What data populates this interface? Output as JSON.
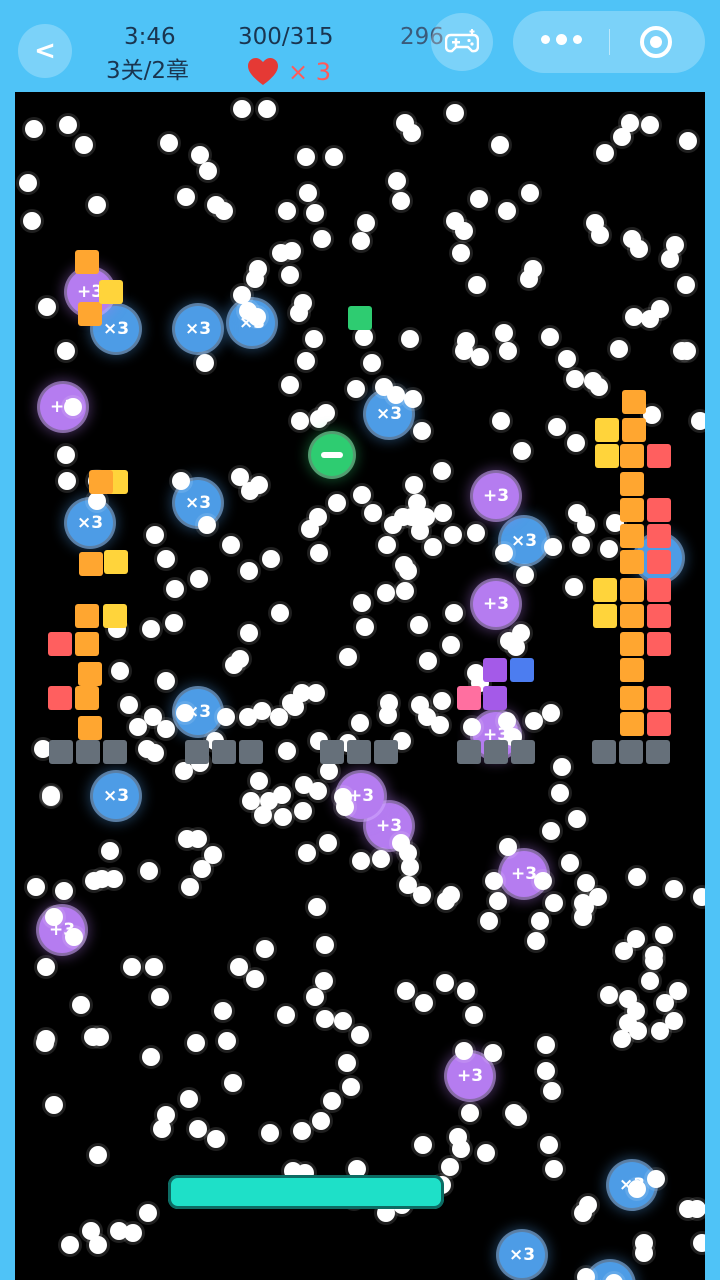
{
  "hud": {
    "back_label": "<",
    "time": "3:46",
    "level": "3关/2章",
    "score": "300/315",
    "extra": "296",
    "lives": "× 3"
  },
  "icons": [
    "chevron-left-icon",
    "heart-icon",
    "gamepad-icon",
    "more-dots-icon",
    "target-icon",
    "minus-icon"
  ],
  "powerups": {
    "multiply_label": "×3",
    "plus_label": "+3"
  },
  "colors": {
    "frame": "#4fc3f7",
    "board": "#000000",
    "paddle": "#1ee0c8",
    "multiply_powerup": "#4d9ce6",
    "plus_powerup": "#b57cf0",
    "shrink_powerup": "#2ecc71",
    "heart": "#e53935",
    "brick_orange": "#ffa630",
    "brick_yellow": "#ffd43b",
    "brick_red": "#ff5f5f",
    "brick_pink": "#ff6fa0",
    "brick_purple": "#a45ae8",
    "brick_blue": "#4c7df0",
    "brick_green": "#2ecc71",
    "brick_gray": "#66707a"
  }
}
